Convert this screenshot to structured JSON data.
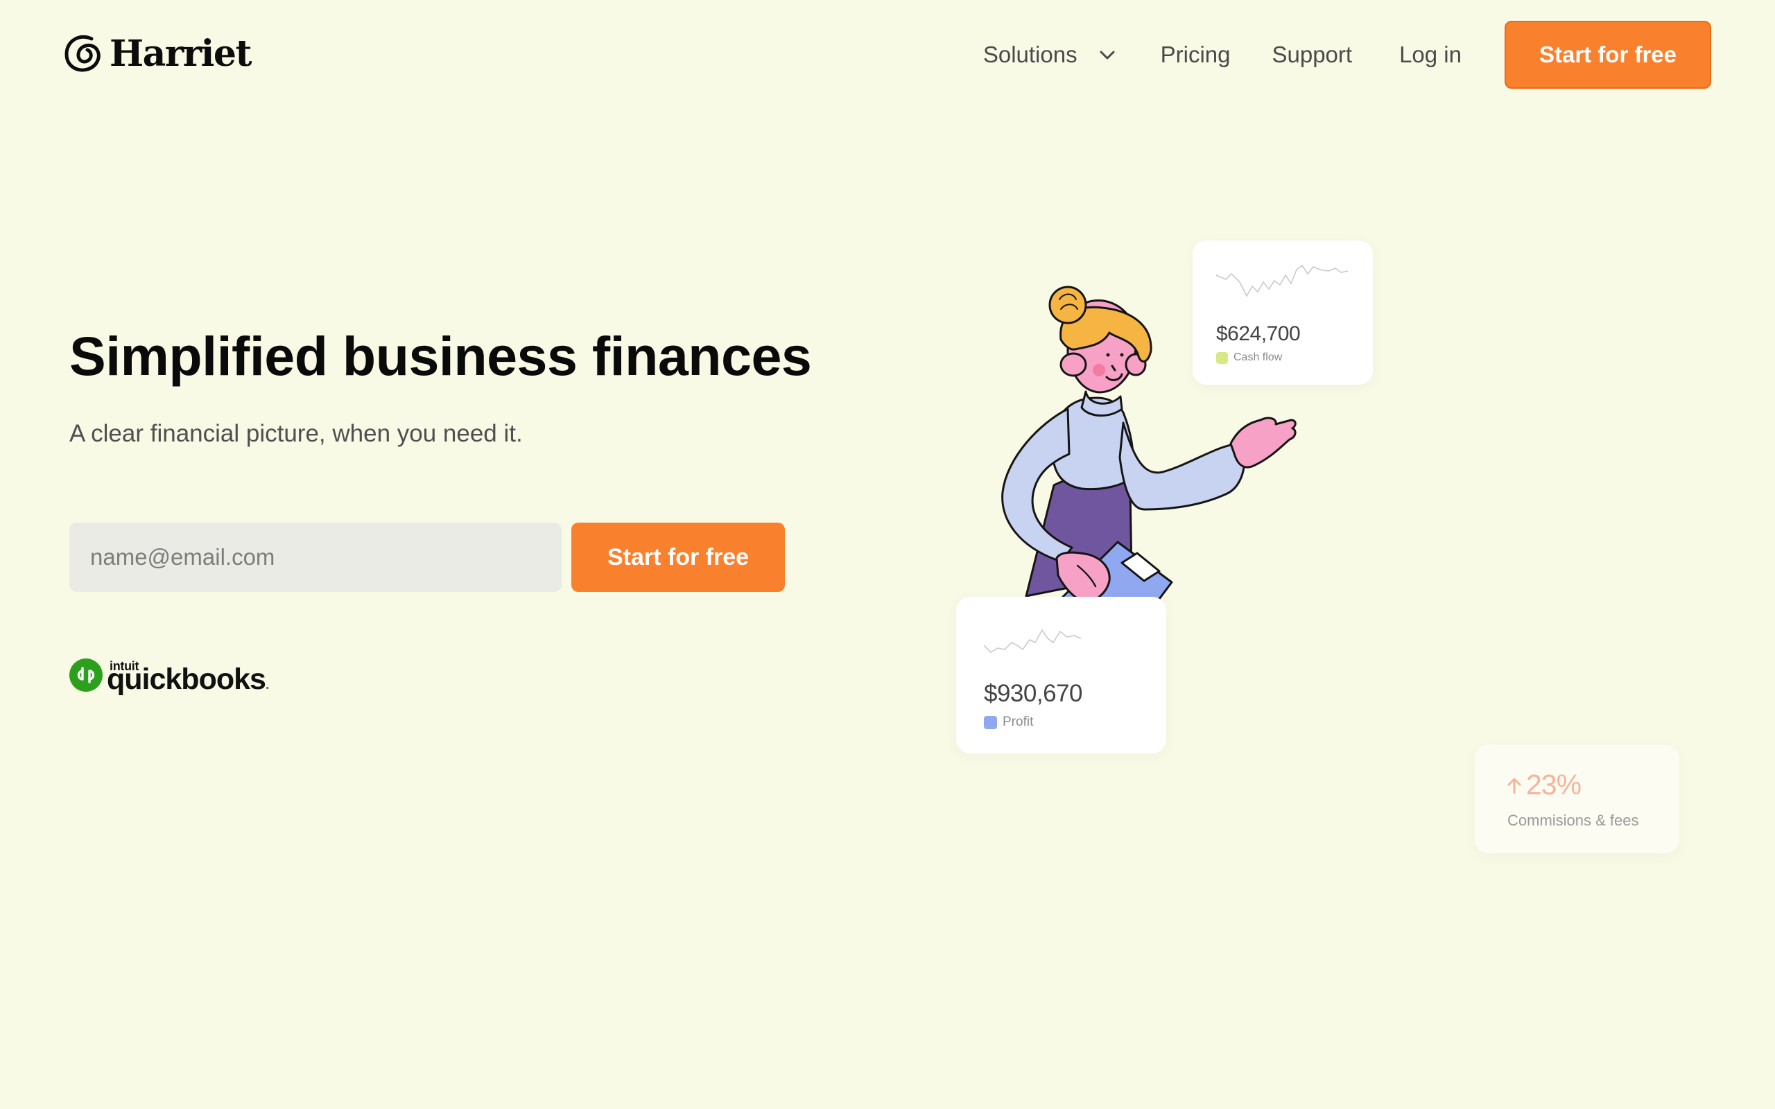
{
  "brand": {
    "name": "Harriet"
  },
  "nav": {
    "solutions": "Solutions",
    "pricing": "Pricing",
    "support": "Support",
    "login": "Log in",
    "cta": "Start for free"
  },
  "hero": {
    "title": "Simplified business finances",
    "subtitle": "A clear financial picture, when you need it.",
    "email_placeholder": "name@email.com",
    "cta": "Start for free"
  },
  "partner": {
    "intuit": "intuit",
    "name": "quickbooks",
    "dot": "."
  },
  "cards": {
    "cash_flow": {
      "amount": "$624,700",
      "label": "Cash flow",
      "color": "#d6e985"
    },
    "profit": {
      "amount": "$930,670",
      "label": "Profit",
      "color": "#8fa8ef"
    },
    "commissions": {
      "percent": "23%",
      "label": "Commisions & fees",
      "color": "#f7b49a"
    }
  },
  "colors": {
    "background": "#f9fae6",
    "accent": "#f9802d",
    "quickbooks": "#2ca01c"
  }
}
